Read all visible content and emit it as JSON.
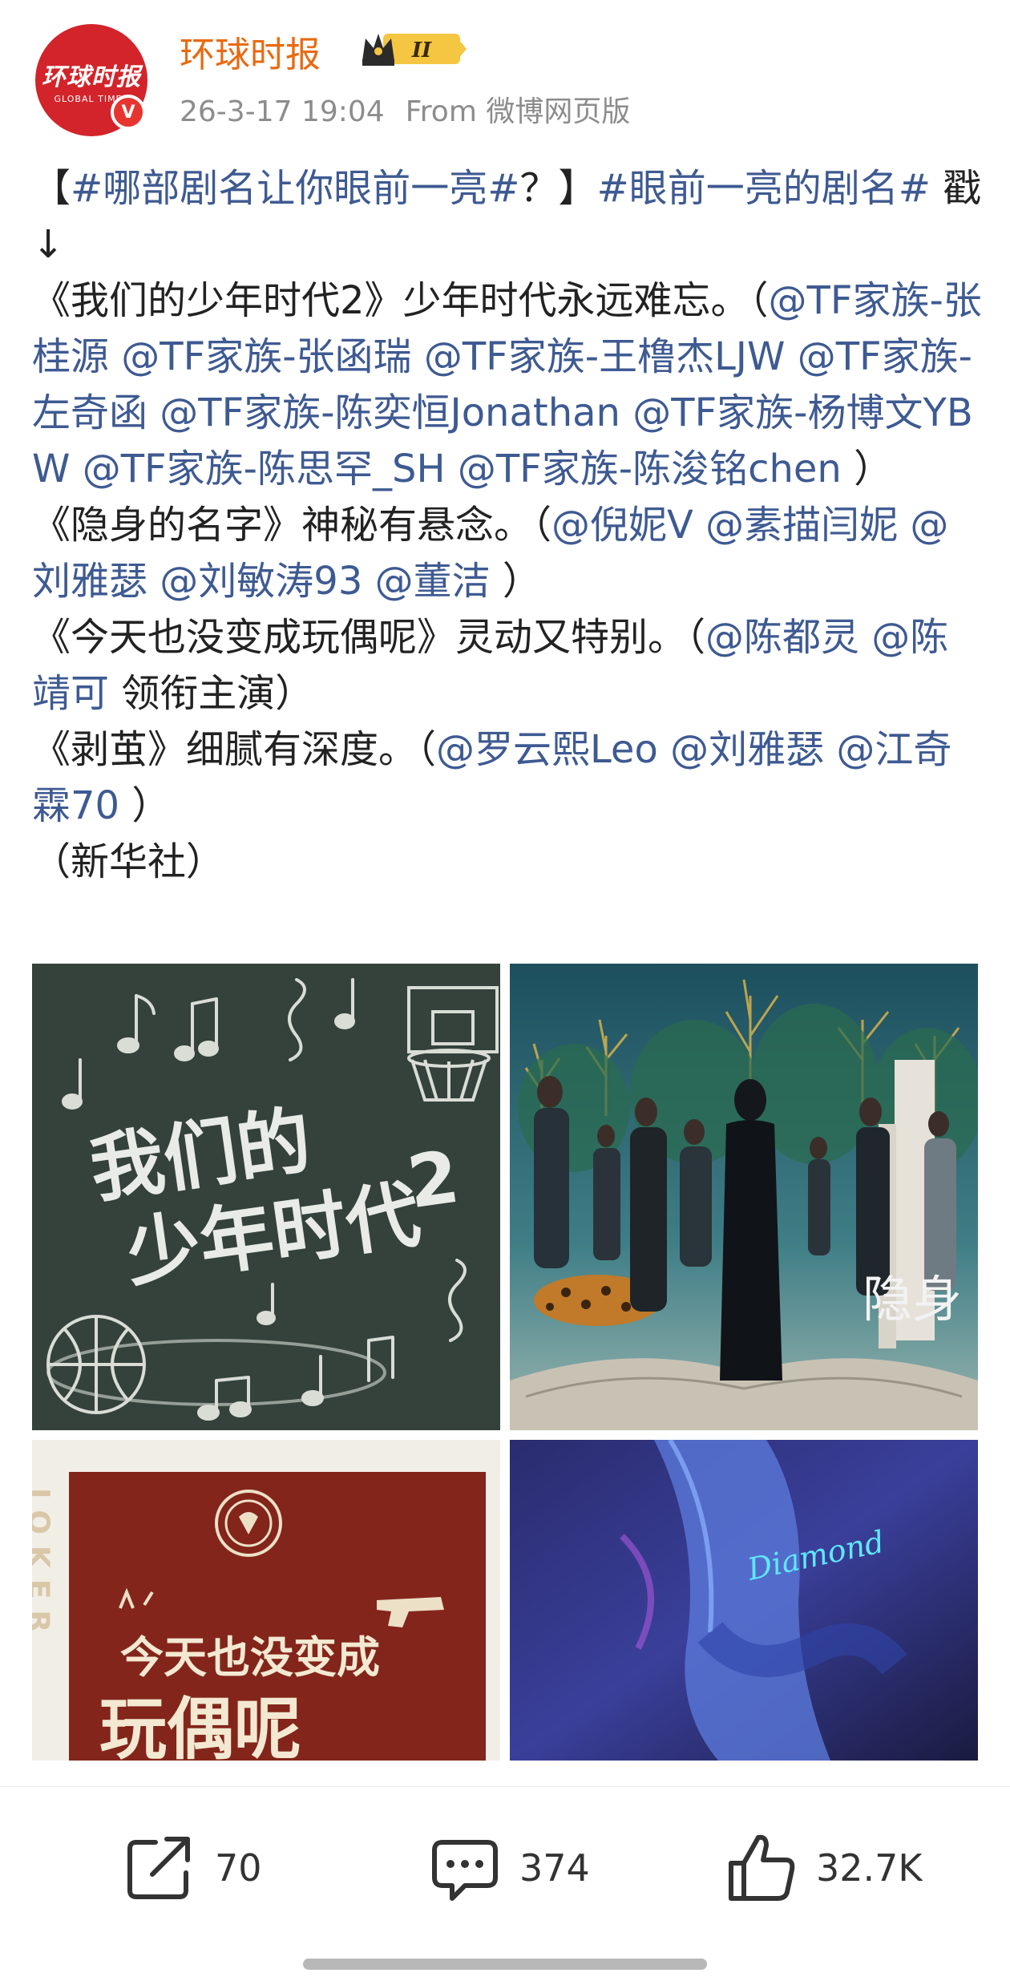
{
  "header": {
    "avatar_text": "环球时报",
    "avatar_subtext": "GLOBAL TIMES",
    "verified_badge": "V",
    "username": "环球时报",
    "rank_level": "II",
    "timestamp": "26-3-17 19:04",
    "source": "From 微博网页版"
  },
  "post": {
    "p1": "【",
    "p1_topic": "#哪部剧名让你眼前一亮#",
    "p1_q": "？】",
    "p1_topic2": "#眼前一亮的剧名#",
    "p1_end": " 戳↓",
    "p2": "《我们的少年时代2》少年时代永远难忘。（",
    "p2_m1": "@TF家族-张桂源",
    "p2_m2": "@TF家族-张函瑞",
    "p2_m3": "@TF家族-王橹杰LJW",
    "p2_m4": "@TF家族-左奇函",
    "p2_m5": "@TF家族-陈奕恒Jonathan",
    "p2_m6": "@TF家族-杨博文YBW",
    "p2_m7": "@TF家族-陈思罕_SH",
    "p2_m8": "@TF家族-陈浚铭chen",
    "p2_end": " ）",
    "p3": "《隐身的名字》神秘有悬念。（",
    "p3_m1": "@倪妮V",
    "p3_m2": "@素描闫妮",
    "p3_m3": "@刘雅瑟",
    "p3_m4": "@刘敏涛93",
    "p3_m5": "@董洁",
    "p3_end": " ）",
    "p4": "《今天也没变成玩偶呢》灵动又特别。（",
    "p4_m1": "@陈都灵",
    "p4_m2": "@陈靖可",
    "p4_end": " 领衔主演）",
    "p5": "《剥茧》细腻有深度。（",
    "p5_m1": "@罗云熙Leo",
    "p5_m2": "@刘雅瑟",
    "p5_m3": "@江奇霖70",
    "p5_end": " ）",
    "p6": "（新华社）"
  },
  "images": {
    "img1_title_line1": "我们的",
    "img1_title_line2": "少年时代",
    "img1_number": "2",
    "img2_text": "隐身",
    "img3_side": "JOKER",
    "img3_title_line1": "今天也没变成",
    "img3_title_line2": "玩偶呢",
    "img4_text": "Diamond"
  },
  "actions": {
    "share_count": "70",
    "comment_count": "374",
    "like_count": "32.7K"
  },
  "colors": {
    "username": "#e86a12",
    "link": "#3e5a92",
    "meta": "#8c8c8c",
    "avatar_bg": "#d2242a"
  },
  "icons": {
    "share": "share-icon",
    "comment": "comment-icon",
    "like": "thumbs-up-icon",
    "verified": "verified-v-icon",
    "rank": "crown-rank-icon"
  }
}
